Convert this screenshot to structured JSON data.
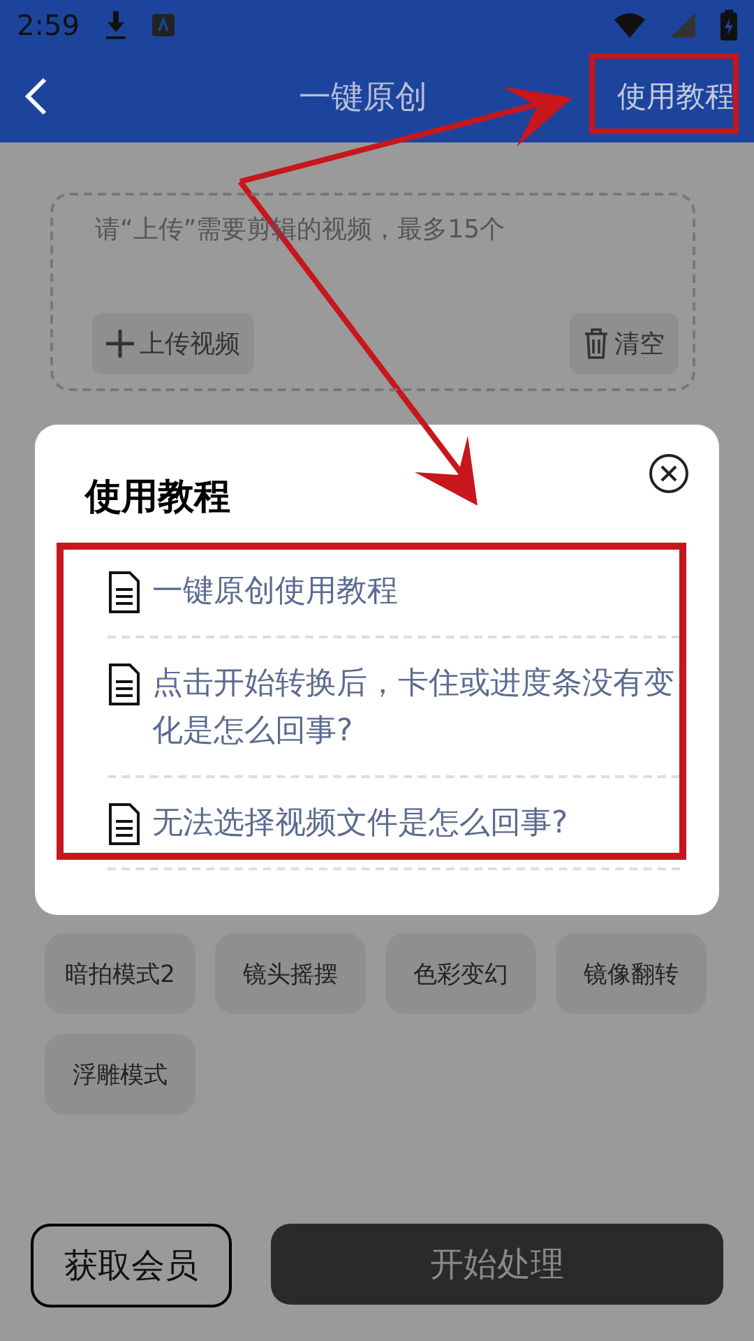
{
  "status_bar": {
    "time": "2:59"
  },
  "header": {
    "title": "一键原创",
    "action": "使用教程"
  },
  "upload_area": {
    "placeholder": "请“上传”需要剪辑的视频，最多15个",
    "upload_button": "上传视频",
    "clear_button": "清空"
  },
  "effects": [
    "暗拍模式2",
    "镜头摇摆",
    "色彩变幻",
    "镜像翻转",
    "浮雕模式"
  ],
  "dialog": {
    "title": "使用教程",
    "items": [
      "一键原创使用教程",
      "点击开始转换后，卡住或进度条没有变化是怎么回事?",
      "无法选择视频文件是怎么回事?"
    ]
  },
  "buttons": {
    "member": "获取会员",
    "start": "开始处理"
  }
}
